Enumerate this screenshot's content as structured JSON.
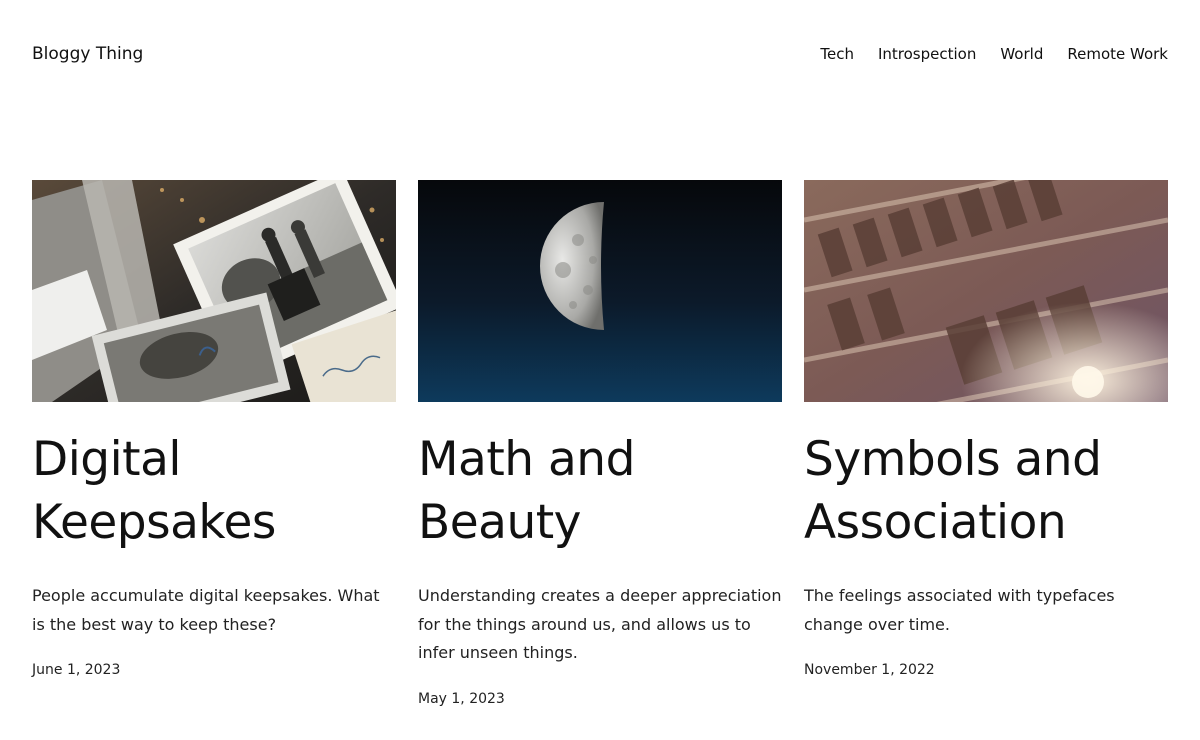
{
  "site": {
    "title": "Bloggy Thing"
  },
  "nav": {
    "items": [
      {
        "label": "Tech"
      },
      {
        "label": "Introspection"
      },
      {
        "label": "World"
      },
      {
        "label": "Remote Work"
      }
    ]
  },
  "posts": [
    {
      "title_line1": "Digital",
      "title_line2": "Keepsakes",
      "excerpt": "People accumulate digital keepsakes. What is the best way to keep these?",
      "date": "June 1, 2023",
      "image": "old-photographs"
    },
    {
      "title_line1": "Math and",
      "title_line2": "Beauty",
      "excerpt": "Understanding creates a deeper appreciation for the things around us, and allows us to infer unseen things.",
      "date": "May 1, 2023",
      "image": "half-moon"
    },
    {
      "title_line1": "Symbols and",
      "title_line2": "Association",
      "excerpt": "The feelings associated with typefaces change over time.",
      "date": "November 1, 2022",
      "image": "letterpress-type"
    }
  ]
}
